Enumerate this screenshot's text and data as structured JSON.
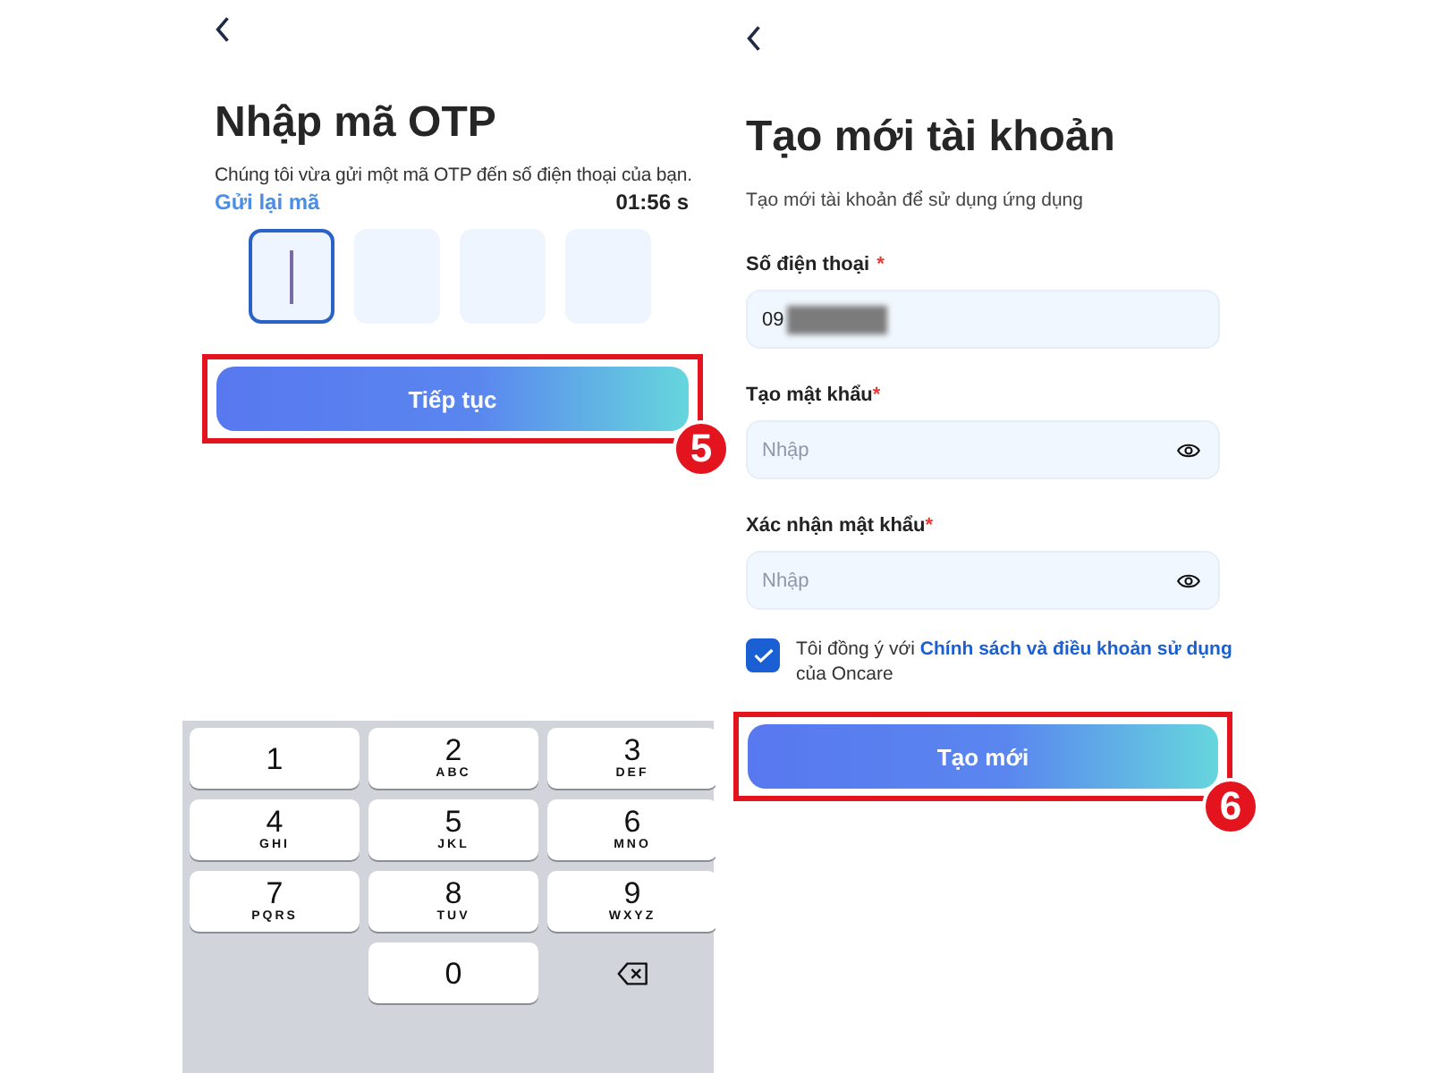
{
  "otp_screen": {
    "title": "Nhập mã OTP",
    "message": "Chúng tôi vừa gửi một mã OTP đến số điện thoại của bạn.",
    "resend_link": "Gửi lại mã",
    "countdown": "01:56 s",
    "code_boxes": [
      {
        "focused": true
      },
      {
        "focused": false
      },
      {
        "focused": false
      },
      {
        "focused": false
      }
    ],
    "continue_button": {
      "label": "Tiếp tục",
      "highlighted": true,
      "step": "5"
    },
    "keypad": [
      {
        "kind": "digit",
        "digit": "1"
      },
      {
        "kind": "digit",
        "digit": "2",
        "letters": "ABC"
      },
      {
        "kind": "digit",
        "digit": "3",
        "letters": "DEF"
      },
      {
        "kind": "digit",
        "digit": "4",
        "letters": "GHI"
      },
      {
        "kind": "digit",
        "digit": "5",
        "letters": "JKL"
      },
      {
        "kind": "digit",
        "digit": "6",
        "letters": "MNO"
      },
      {
        "kind": "digit",
        "digit": "7",
        "letters": "PQRS"
      },
      {
        "kind": "digit",
        "digit": "8",
        "letters": "TUV"
      },
      {
        "kind": "digit",
        "digit": "9",
        "letters": "WXYZ"
      },
      {
        "kind": "blank"
      },
      {
        "kind": "digit",
        "digit": "0"
      },
      {
        "kind": "delete"
      }
    ]
  },
  "signup_screen": {
    "title": "Tạo mới tài khoản",
    "subtitle": "Tạo mới tài khoản để sử dụng ứng dụng",
    "fields": [
      {
        "kind": "phone",
        "label": "Số điện thoại",
        "required": "*",
        "value": "09",
        "redacted": true
      },
      {
        "kind": "password",
        "label": "Tạo mật khẩu",
        "required": "*",
        "placeholder": "Nhập"
      },
      {
        "kind": "password",
        "label": "Xác nhận mật khẩu",
        "required": "*",
        "placeholder": "Nhập"
      }
    ],
    "agreement": {
      "checked": true,
      "text": "Tôi đồng ý với",
      "link": "Chính sách và điều khoản sử dụng",
      "suffix": "của Oncare"
    },
    "create_button": {
      "label": "Tạo mới",
      "highlighted": true,
      "step": "6"
    }
  }
}
